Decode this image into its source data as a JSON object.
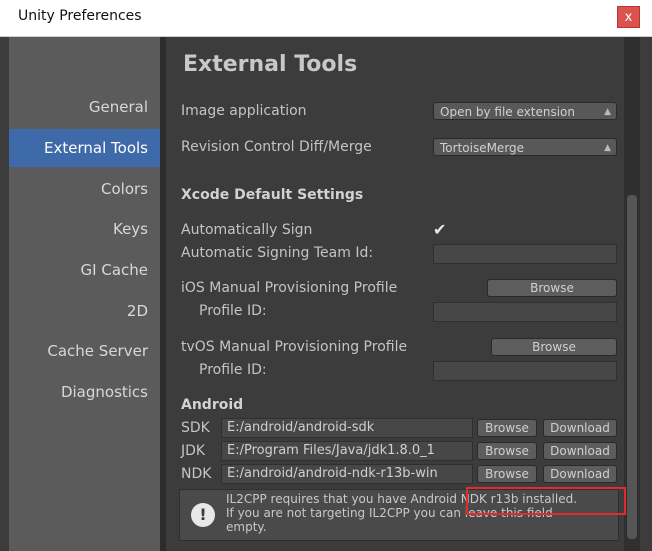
{
  "window": {
    "title": "Unity Preferences",
    "close_label": "x"
  },
  "sidebar": {
    "items": [
      {
        "label": "General",
        "active": false
      },
      {
        "label": "External Tools",
        "active": true
      },
      {
        "label": "Colors",
        "active": false
      },
      {
        "label": "Keys",
        "active": false
      },
      {
        "label": "GI Cache",
        "active": false
      },
      {
        "label": "2D",
        "active": false
      },
      {
        "label": "Cache Server",
        "active": false
      },
      {
        "label": "Diagnostics",
        "active": false
      }
    ]
  },
  "main": {
    "title": "External Tools",
    "image_application": {
      "label": "Image application",
      "value": "Open by file extension"
    },
    "revision_control": {
      "label": "Revision Control Diff/Merge",
      "value": "TortoiseMerge"
    },
    "xcode": {
      "heading": "Xcode Default Settings",
      "auto_sign_label": "Automatically Sign",
      "auto_sign_checked": true,
      "team_id_label": "Automatic Signing Team Id:",
      "team_id_value": "",
      "ios_profile_label": "iOS Manual Provisioning Profile",
      "ios_browse": "Browse",
      "ios_profile_id_label": "Profile ID:",
      "ios_profile_id_value": "",
      "tvos_profile_label": "tvOS Manual Provisioning Profile",
      "tvos_browse": "Browse",
      "tvos_profile_id_label": "Profile ID:",
      "tvos_profile_id_value": ""
    },
    "android": {
      "heading": "Android",
      "sdk": {
        "label": "SDK",
        "path": "E:/android/android-sdk",
        "browse": "Browse",
        "download": "Download"
      },
      "jdk": {
        "label": "JDK",
        "path": "E:/Program Files/Java/jdk1.8.0_1",
        "browse": "Browse",
        "download": "Download"
      },
      "ndk": {
        "label": "NDK",
        "path": "E:/android/android-ndk-r13b-win",
        "browse": "Browse",
        "download": "Download"
      }
    },
    "help": {
      "line1": "IL2CPP requires that you have Android NDK r13b installed.",
      "line2": "If you are not targeting IL2CPP you can leave this field",
      "line3": "empty."
    }
  },
  "colors": {
    "accent": "#3e6aaa",
    "highlight_box": "#e22b2b"
  }
}
